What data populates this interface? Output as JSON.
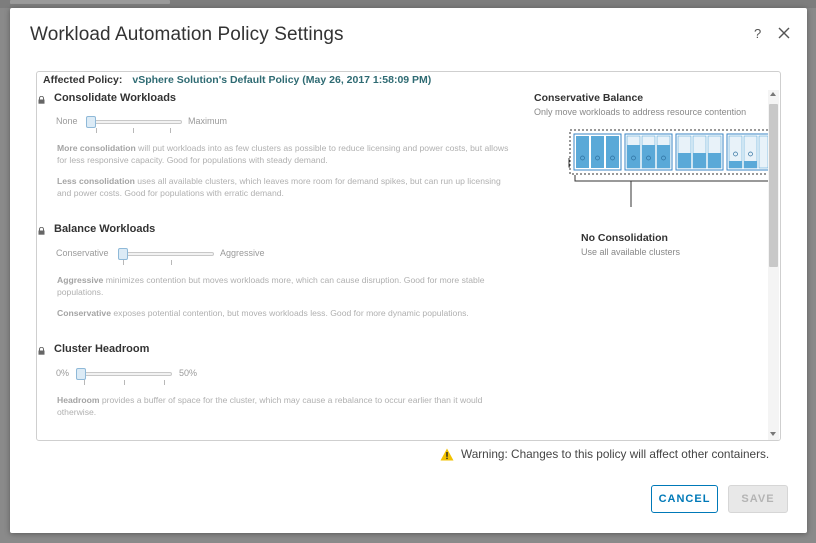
{
  "dialog": {
    "title": "Workload Automation Policy Settings",
    "help_label": "?",
    "close_icon": "close-icon"
  },
  "affected": {
    "label": "Affected Policy:",
    "policy": "vSphere Solution's Default Policy (May 26, 2017 1:58:09 PM)"
  },
  "sections": {
    "consolidate": {
      "title": "Consolidate Workloads",
      "slider": {
        "min_label": "None",
        "max_label": "Maximum",
        "value": 0
      },
      "more_bold": "More consolidation",
      "more_text": "will put workloads into as few clusters as possible to reduce licensing and power costs, but allows for less responsive capacity. Good for populations with steady demand.",
      "less_bold": "Less consolidation",
      "less_text": "uses all available clusters, which leaves more room for demand spikes, but can run up licensing and power costs. Good for populations with erratic demand."
    },
    "balance": {
      "title": "Balance Workloads",
      "slider": {
        "min_label": "Conservative",
        "max_label": "Aggressive",
        "value": 0
      },
      "aggr_bold": "Aggressive",
      "aggr_text": "minimizes contention but moves workloads more, which can cause disruption. Good for more stable populations.",
      "cons_bold": "Conservative",
      "cons_text": "exposes potential contention, but moves workloads less. Good for more dynamic populations."
    },
    "headroom": {
      "title": "Cluster Headroom",
      "slider": {
        "min_label": "0%",
        "max_label": "50%",
        "value": 0
      },
      "head_bold": "Headroom",
      "head_text": "provides a buffer of space for the cluster, which may cause a rebalance to occur earlier than it would otherwise."
    }
  },
  "preview": {
    "balance_title": "Conservative Balance",
    "balance_sub": "Only move workloads to address resource contention",
    "consolidation_title": "No Consolidation",
    "consolidation_sub": "Use all available clusters"
  },
  "footer": {
    "warning": "Warning: Changes to this policy will affect other containers.",
    "cancel": "CANCEL",
    "save": "SAVE"
  },
  "colors": {
    "accent": "#0079b8",
    "warning": "#f2c200",
    "cluster_blue": "#5aa9d8"
  }
}
